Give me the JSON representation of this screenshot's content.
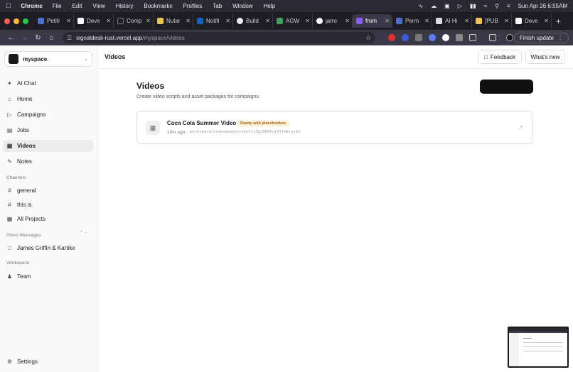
{
  "menubar": {
    "app": "Chrome",
    "menus": [
      "File",
      "Edit",
      "View",
      "History",
      "Bookmarks",
      "Profiles",
      "Tab",
      "Window",
      "Help"
    ],
    "datetime": "Sun Apr 26  6:55AM"
  },
  "tabs": [
    {
      "label": "Petiti",
      "color": "#4a6fd6"
    },
    {
      "label": "Deve",
      "color": "#ffffff"
    },
    {
      "label": "Comp",
      "color": "#222222"
    },
    {
      "label": "Nutar",
      "color": "#f2c14e"
    },
    {
      "label": "Notifi",
      "color": "#0a66c2"
    },
    {
      "label": "Build",
      "color": "#eeeeee"
    },
    {
      "label": "AGW",
      "color": "#3aa55d"
    },
    {
      "label": "jarro",
      "color": "#ffffff"
    },
    {
      "label": "from",
      "color": "#8b5cf6",
      "active": true
    },
    {
      "label": "Perm",
      "color": "#4a6fd6"
    },
    {
      "label": "AI Hi",
      "color": "#dddddd"
    },
    {
      "label": "[PUB",
      "color": "#f2c14e"
    },
    {
      "label": "Deve",
      "color": "#ffffff"
    }
  ],
  "address": {
    "domain": "signaldesk-rust.vercel.app",
    "path": "/myspace/videos",
    "finish_update": "Finish update"
  },
  "workspace": {
    "name": "myspace"
  },
  "nav": {
    "ai_chat": "AI Chat",
    "home": "Home",
    "campaigns": "Campaigns",
    "jobs": "Jobs",
    "videos": "Videos",
    "notes": "Notes"
  },
  "channels": {
    "label": "Channels",
    "general": "general",
    "this_is": "this is",
    "all_projects": "All Projects"
  },
  "direct_messages": {
    "label": "Direct Messages",
    "item": "James Griffin & Kartike"
  },
  "workspace_section": {
    "label": "Workspace",
    "team": "Team"
  },
  "settings": "Settings",
  "header": {
    "title": "Videos",
    "feedback": "Feedback",
    "whats_new": "What's new"
  },
  "page": {
    "title": "Videos",
    "subtitle": "Create video scripts and asset packages for campaigns."
  },
  "video": {
    "title": "Coca Cola Summer Video",
    "status": "Ready with placeholders",
    "time": "10m ago",
    "path": "workspace/videoassets/cmofti5g20005qr0lfm6rsc8o"
  }
}
